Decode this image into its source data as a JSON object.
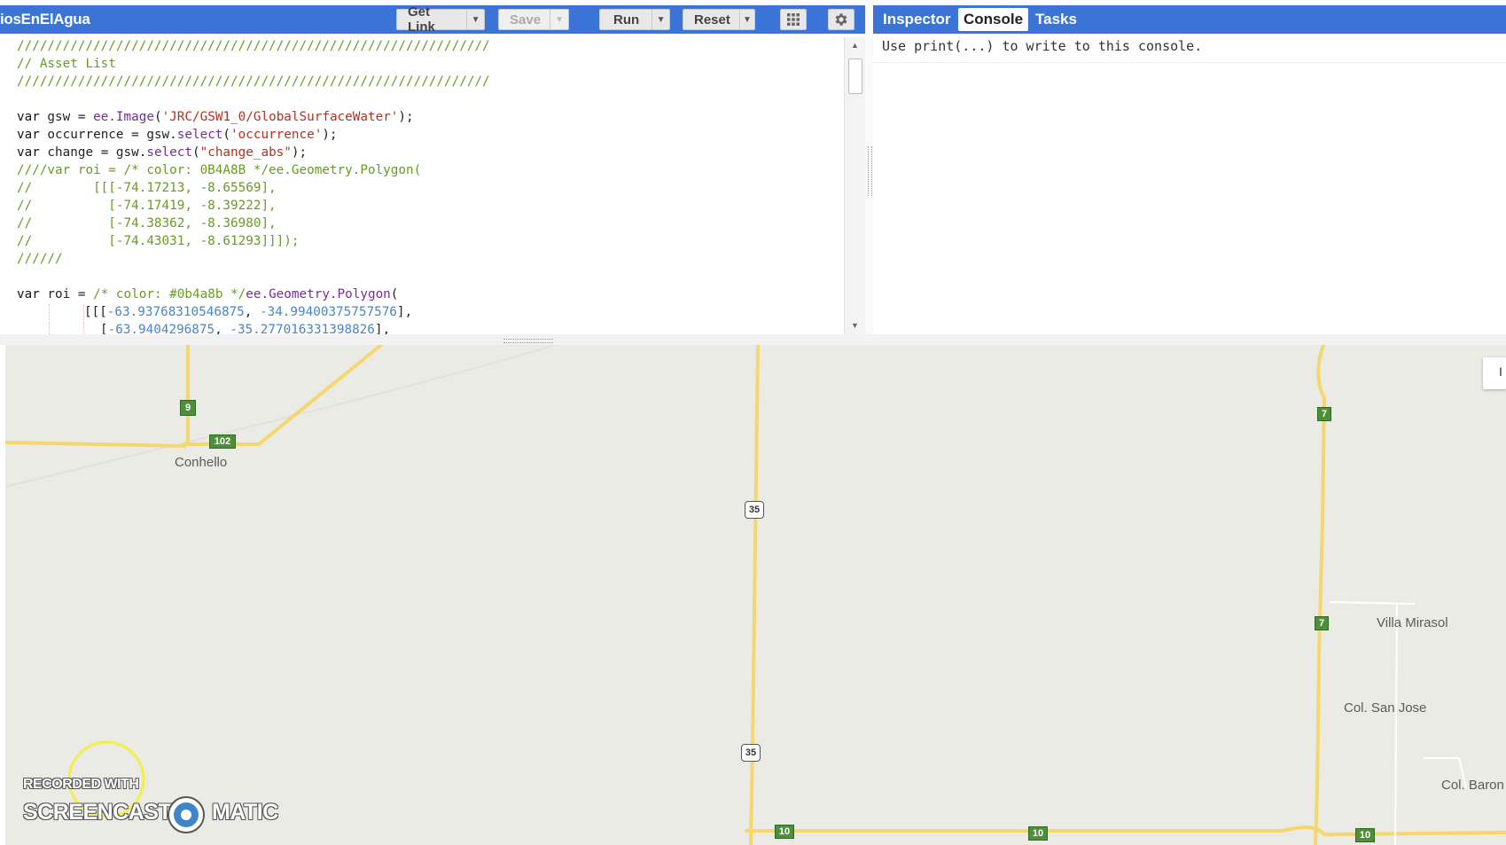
{
  "toolbar": {
    "script_title": "iosEnElAgua",
    "get_link_label": "Get Link",
    "save_label": "Save",
    "run_label": "Run",
    "reset_label": "Reset",
    "dropdown_glyph": "▼",
    "apps_icon": "grid-icon",
    "settings_icon": "gear-icon"
  },
  "code": {
    "line1": "//////////////////////////////////////////////////////////////",
    "line2": "// Asset List",
    "line3": "//////////////////////////////////////////////////////////////",
    "l5_kw": "var",
    "l5_a": " gsw = ",
    "l5_ee": "ee.Image",
    "l5_b": "(",
    "l5_str": "'JRC/GSW1_0/GlobalSurfaceWater'",
    "l5_c": ");",
    "l6_kw": "var",
    "l6_a": " occurrence = gsw.",
    "l6_fn": "select",
    "l6_b": "(",
    "l6_str": "'occurrence'",
    "l6_c": ");",
    "l7_kw": "var",
    "l7_a": " change = gsw.",
    "l7_fn": "select",
    "l7_b": "(",
    "l7_str": "\"change_abs\"",
    "l7_c": ");",
    "line8": "////var roi = /* color: 0B4A8B */ee.Geometry.Polygon(",
    "line9": "//        [[[-74.17213, -8.65569],",
    "line10": "//          [-74.17419, -8.39222],",
    "line11": "//          [-74.38362, -8.36980],",
    "line12": "//          [-74.43031, -8.61293]]]);",
    "line13": "//////",
    "l15_kw": "var",
    "l15_a": " roi = ",
    "l15_cm": "/* color: #0b4a8b */",
    "l15_ee": "ee.Geometry.Polygon",
    "l15_b": "(",
    "l16_a": "[[[",
    "l16_n1": "-63.93768310546875",
    "l16_b": ", ",
    "l16_n2": "-34.99400375757576",
    "l16_c": "],",
    "l17_a": "[",
    "l17_n1": "-63.9404296875",
    "l17_b": ", ",
    "l17_n2": "-35.277016331398826",
    "l17_c": "],"
  },
  "right_panel": {
    "tabs": [
      "Inspector",
      "Console",
      "Tasks"
    ],
    "active_tab": "Console",
    "console_message": "Use print(...) to write to this console."
  },
  "map": {
    "places": {
      "conhello": "Conhello",
      "villa_mirasol": "Villa Mirasol",
      "col_san_jose": "Col. San Jose",
      "col_baron": "Col. Baron"
    },
    "route_shields": {
      "r9": "9",
      "r102": "102",
      "r35a": "35",
      "r35b": "35",
      "r7a": "7",
      "r7b": "7",
      "r10a": "10",
      "r10b": "10",
      "r10c": "10"
    },
    "right_control_glyph": "I",
    "colors": {
      "land": "#ebebe6",
      "road": "#f5d76e",
      "shield_green": "#4e8f3a"
    }
  },
  "watermark": {
    "line1": "RECORDED WITH",
    "line2a": "SCREENCAST",
    "line2b": "MATIC"
  }
}
